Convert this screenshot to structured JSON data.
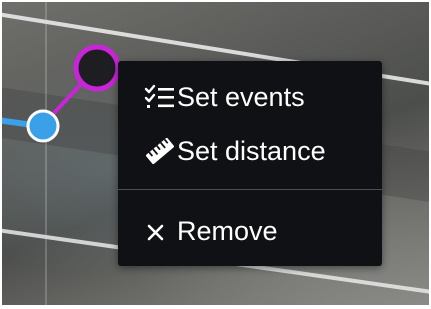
{
  "context_menu": {
    "items": [
      {
        "label": "Set events",
        "icon": "list-check-icon"
      },
      {
        "label": "Set distance",
        "icon": "ruler-icon"
      },
      {
        "label": "Remove",
        "icon": "close-icon"
      }
    ]
  },
  "colors": {
    "menu_background": "#0f1114",
    "menu_text": "#ffffff",
    "selected_vertex": "#1e1e22",
    "selected_vertex_ring": "#c824d8",
    "connector_line": "#c824d8",
    "vertex": "#3aa0e8",
    "track_line": "#3aa0e8"
  }
}
